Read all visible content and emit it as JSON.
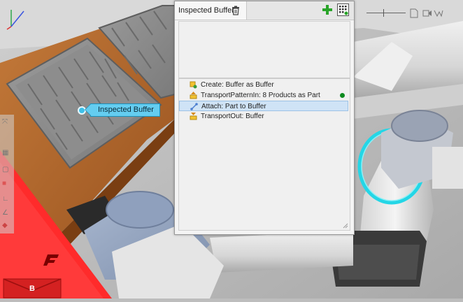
{
  "viewport": {
    "callout_label": "Inspected Buffer",
    "mail_badge_letter": "B"
  },
  "panel": {
    "title": "Inspected Buffer",
    "icons": {
      "delete": "trash-icon",
      "add": "plus-icon",
      "grid": "grid-settings-icon"
    },
    "items": [
      {
        "label": "Create: Buffer as Buffer",
        "icon": "create-icon",
        "selected": false,
        "status": false
      },
      {
        "label": "TransportPatternIn: 8 Products as Part",
        "icon": "transport-in-icon",
        "selected": false,
        "status": true
      },
      {
        "label": "Attach: Part to Buffer",
        "icon": "attach-icon",
        "selected": true,
        "status": false
      },
      {
        "label": "TransportOut: Buffer",
        "icon": "transport-out-icon",
        "selected": false,
        "status": false
      }
    ]
  },
  "colors": {
    "accent_cyan": "#64cdf0",
    "status_green": "#0b8a1f",
    "add_green": "#2aa52a",
    "selection": "#cfe3f6",
    "brand_red": "#ff2b2b"
  }
}
